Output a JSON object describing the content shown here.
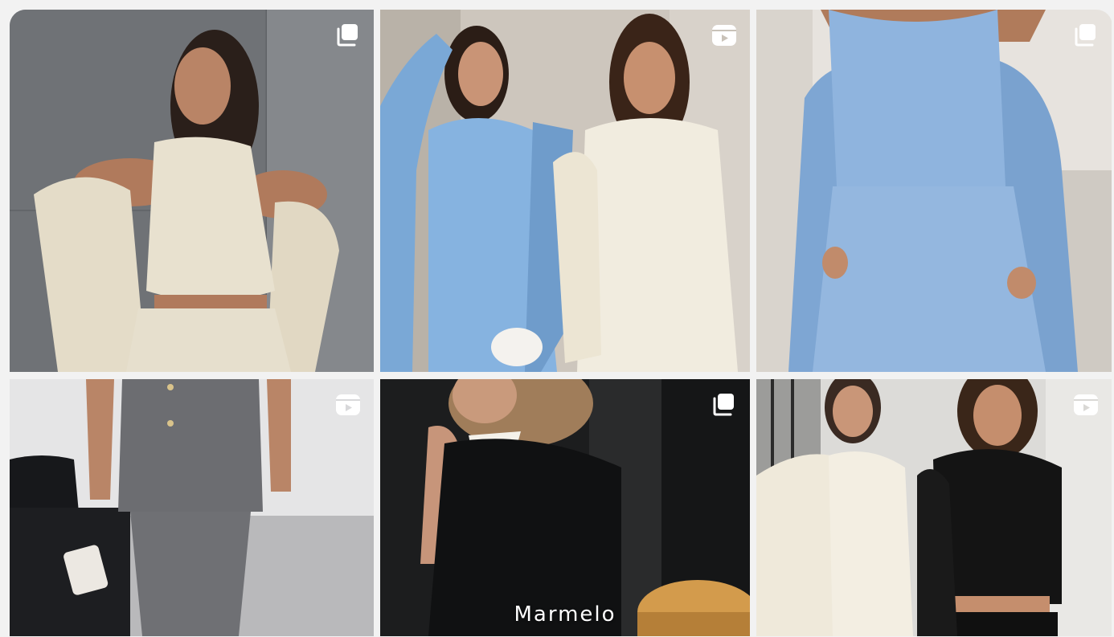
{
  "tiles": [
    {
      "id": "post-1",
      "badge": "carousel-icon",
      "caption": ""
    },
    {
      "id": "post-2",
      "badge": "reel-icon",
      "caption": ""
    },
    {
      "id": "post-3",
      "badge": "carousel-icon",
      "caption": ""
    },
    {
      "id": "post-4",
      "badge": "reel-icon",
      "caption": ""
    },
    {
      "id": "post-5",
      "badge": "carousel-icon",
      "caption": "Marmelo"
    },
    {
      "id": "post-6",
      "badge": "reel-icon",
      "caption": ""
    }
  ],
  "colors": {
    "background": "#f2f2f2",
    "badge": "#ffffff"
  }
}
